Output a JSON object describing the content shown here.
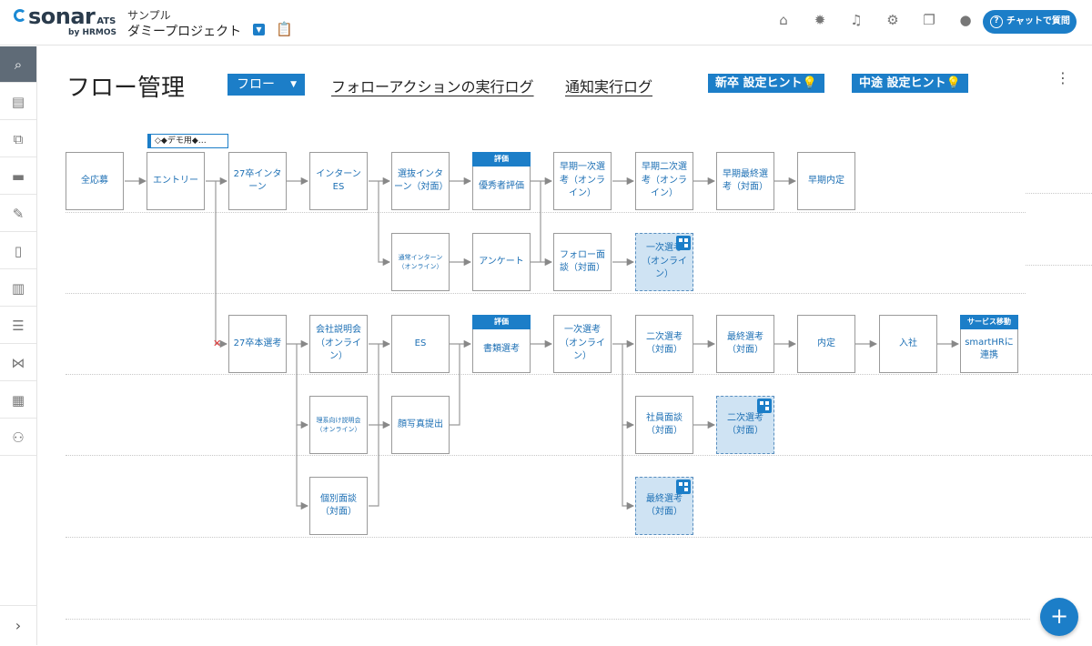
{
  "header": {
    "logo_word": "sonar",
    "logo_suffix": "ATS",
    "logo_by": "by HRMOS",
    "project_sub": "サンプル",
    "project_name": "ダミープロジェクト",
    "icons": [
      "home-icon",
      "bug-icon",
      "bell-icon",
      "gear-icon",
      "book-icon",
      "user-icon"
    ],
    "chat_label": "チャットで質問"
  },
  "sidebar": {
    "items": [
      "search-icon",
      "clipboard-icon",
      "hierarchy-icon",
      "chat-icon",
      "wrench-icon",
      "phone-icon",
      "bar-chart-icon",
      "database-icon",
      "handshake-icon",
      "report-icon",
      "people-icon"
    ],
    "collapse": "chevron-right-icon"
  },
  "page": {
    "title": "フロー管理",
    "flow_dropdown": "フロー",
    "link_follow": "フォローアクションの実行ログ",
    "link_notice": "通知実行ログ",
    "hint_new": "新卒 設定ヒント",
    "hint_mid": "中途 設定ヒント",
    "demo_tag": "◇◆デモ用◆…"
  },
  "flow": {
    "n_boshu": "全応募",
    "n_entry": "エントリー",
    "n_intern27": "27卒インターン",
    "n_intern_es": "インターンES",
    "n_senbatsu": "選抜インターン（対面）",
    "n_yushu_badge": "評価",
    "n_yushu": "優秀者評価",
    "n_early1": "早期一次選考（オンライン）",
    "n_early2": "早期二次選考（オンライン）",
    "n_early_final": "早期最終選考（対面）",
    "n_early_offer": "早期内定",
    "n_tsujo": "通常インターン（オンライン）",
    "n_survey": "アンケート",
    "n_follow": "フォロー面談（対面）",
    "n_sub_1ji": "一次選考（オンライン）",
    "n_honsen": "27卒本選考",
    "n_setsumei": "会社説明会（オンライン）",
    "n_es": "ES",
    "n_shorui_badge": "評価",
    "n_shorui": "書類選考",
    "n_1ji": "一次選考（オンライン）",
    "n_2ji": "二次選考（対面）",
    "n_final": "最終選考（対面）",
    "n_naitei": "内定",
    "n_nyusha": "入社",
    "n_service_badge": "サービス移動",
    "n_service": "smartHRに連携",
    "n_rikei": "理系向け説明会（オンライン）",
    "n_photo": "顔写真提出",
    "n_shain": "社員面談（対面）",
    "n_sub_2ji": "二次選考（対面）",
    "n_kobetsu": "個別面談（対面）",
    "n_sub_final": "最終選考（対面）"
  },
  "fab_label": "+"
}
